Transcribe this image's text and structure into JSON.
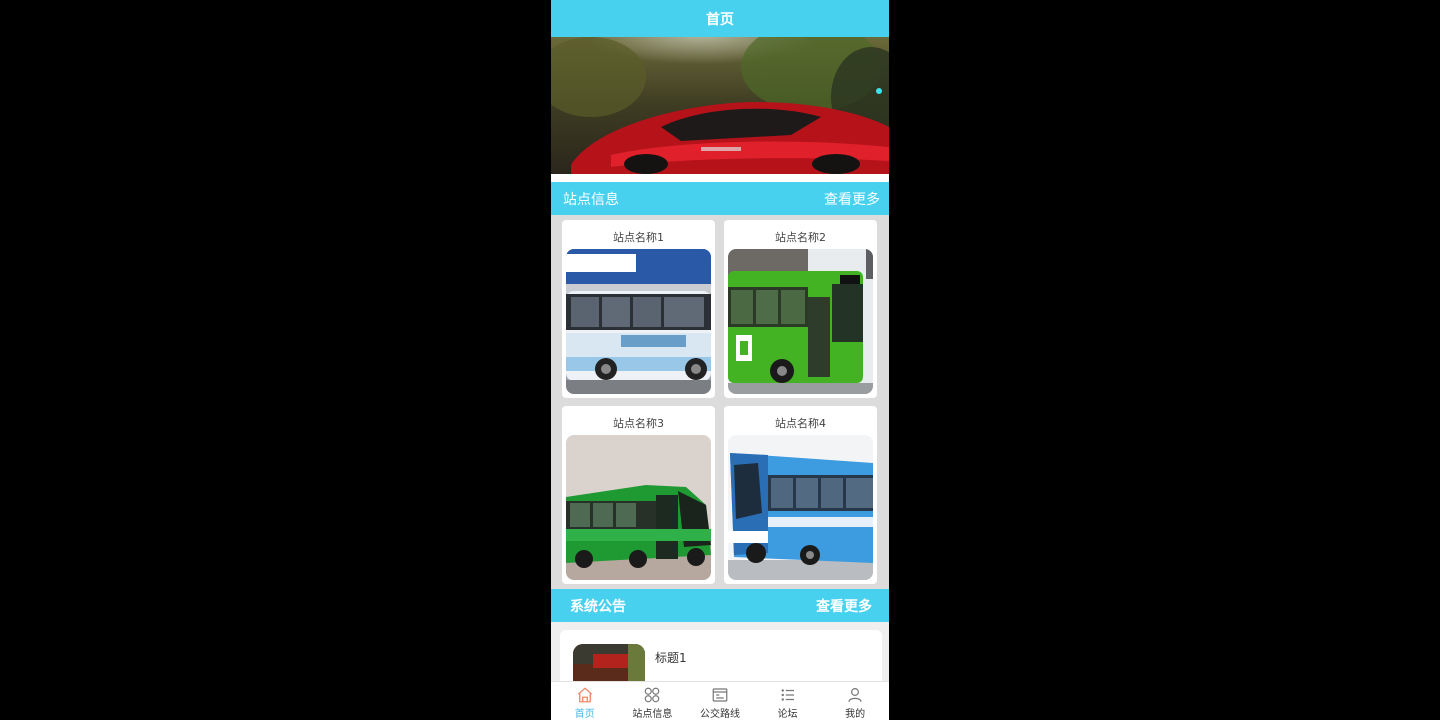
{
  "header": {
    "title": "首页"
  },
  "stations_section": {
    "title": "站点信息",
    "more": "查看更多",
    "items": [
      {
        "name": "站点名称1"
      },
      {
        "name": "站点名称2"
      },
      {
        "name": "站点名称3"
      },
      {
        "name": "站点名称4"
      }
    ]
  },
  "notice_section": {
    "title": "系统公告",
    "more": "查看更多",
    "items": [
      {
        "title": "标题1"
      }
    ]
  },
  "tabbar": {
    "items": [
      {
        "label": "首页",
        "icon": "home-icon",
        "active": true
      },
      {
        "label": "站点信息",
        "icon": "grid-icon",
        "active": false
      },
      {
        "label": "公交路线",
        "icon": "route-icon",
        "active": false
      },
      {
        "label": "论坛",
        "icon": "list-icon",
        "active": false
      },
      {
        "label": "我的",
        "icon": "user-icon",
        "active": false
      }
    ]
  },
  "colors": {
    "accent": "#47d1ef",
    "active_tab": "#47b9e6"
  }
}
